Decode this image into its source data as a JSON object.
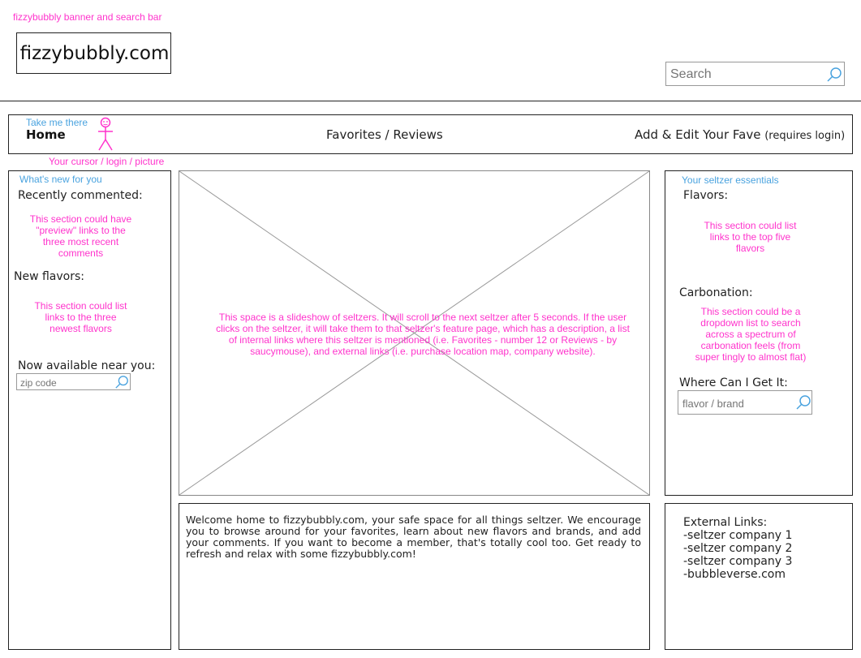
{
  "banner": {
    "label": "fizzybubbly banner and search bar",
    "logo": "fizzybubbly.com",
    "search_placeholder": "Search"
  },
  "nav": {
    "hint": "Take me there",
    "home": "Home",
    "favorites": "Favorites / Reviews",
    "add_edit": "Add & Edit Your Fave",
    "requires_login": "(requires login)",
    "cursor_note": "Your cursor / login / picture"
  },
  "left": {
    "section_label": "What's new for you",
    "recently_commented": "Recently commented:",
    "recent_note": "This section could have \"preview\" links to the three most recent comments",
    "new_flavors": "New flavors:",
    "new_note": "This section could list links to the three newest flavors",
    "near_you": "Now available near you:",
    "zip_placeholder": "zip code"
  },
  "slideshow": {
    "note": "This space is a slideshow of seltzers. It will scroll to the next seltzer after 5 seconds. If the user clicks on the seltzer, it will take them to that seltzer's feature page, which has a description, a list of  internal links where this seltzer is mentioned (i.e. Favorites - number 12 or Reviews - by saucymouse), and external links (i.e. purchase location map, company website)."
  },
  "welcome": {
    "text": "Welcome home to fizzybubbly.com, your safe space for all things seltzer. We encourage you to browse around for your favorites, learn about new flavors and brands, and add your comments. If you want to become a member, that's totally cool too. Get ready to refresh and relax with some fizzybubbly.com!"
  },
  "right": {
    "section_label": "Your seltzer essentials",
    "flavors": "Flavors:",
    "flavors_note": "This section could list links to the top five flavors",
    "carbonation": "Carbonation:",
    "carbonation_note": "This section could be a dropdown list to search across a spectrum of carbonation feels (from super tingly to almost flat)",
    "where": "Where Can I Get It:",
    "where_placeholder": "flavor / brand"
  },
  "external": {
    "title": "External Links:",
    "links": [
      "-seltzer company 1",
      "-seltzer company 2",
      "-seltzer company 3",
      "-bubbleverse.com"
    ]
  },
  "icons": {
    "search": "magnifier-icon",
    "user": "stick-figure-icon",
    "image_placeholder": "x-placeholder-icon"
  },
  "colors": {
    "annotation": "#ff33cc",
    "label_blue": "#4aa3df",
    "search_icon": "#4aa3df"
  }
}
